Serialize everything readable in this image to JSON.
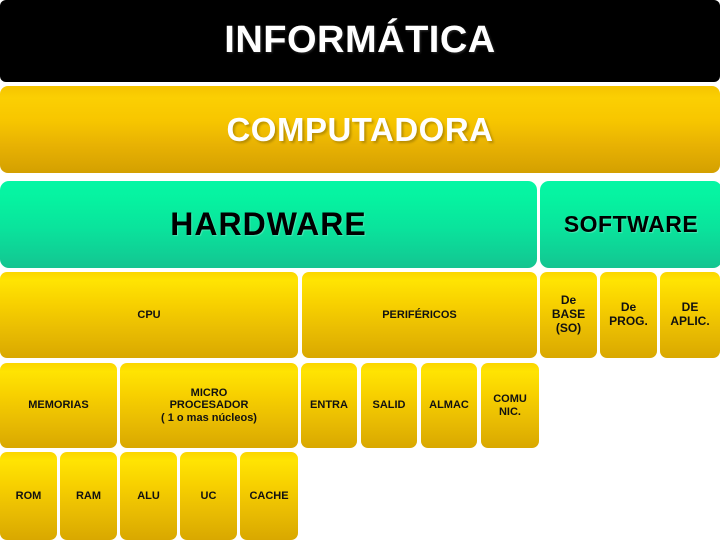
{
  "diagram": {
    "title": "INFORMÁTICA",
    "subtitle": "COMPUTADORA",
    "colors": {
      "title_bg": "#000000",
      "title_text": "#ffffff",
      "subtitle_bg": "#f5c400",
      "subtitle_text": "#ffffff",
      "green_bg": "#05f7a5",
      "yellow_bg": "#fbd500",
      "box_text": "#111111",
      "page_bg": "#ffffff"
    },
    "level_green": {
      "hardware": "HARDWARE",
      "software": "SOFTWARE"
    },
    "level_three": {
      "cpu": "CPU",
      "perifericos": "PERIFÉRICOS",
      "software_base": "De\nBASE\n(SO)",
      "software_prog": "De\nPROG.",
      "software_aplic": "DE\nAPLIC."
    },
    "level_four": {
      "memorias": "MEMORIAS",
      "microprocesador": "MICRO\nPROCESADOR\n( 1 o mas núcleos)",
      "entrada": "ENTRA",
      "salida": "SALID",
      "almacenamiento": "ALMAC",
      "comunicacion": "COMU\nNIC."
    },
    "level_five": {
      "rom": "ROM",
      "ram": "RAM",
      "alu": "ALU",
      "uc": "UC",
      "cache": "CACHE"
    }
  }
}
